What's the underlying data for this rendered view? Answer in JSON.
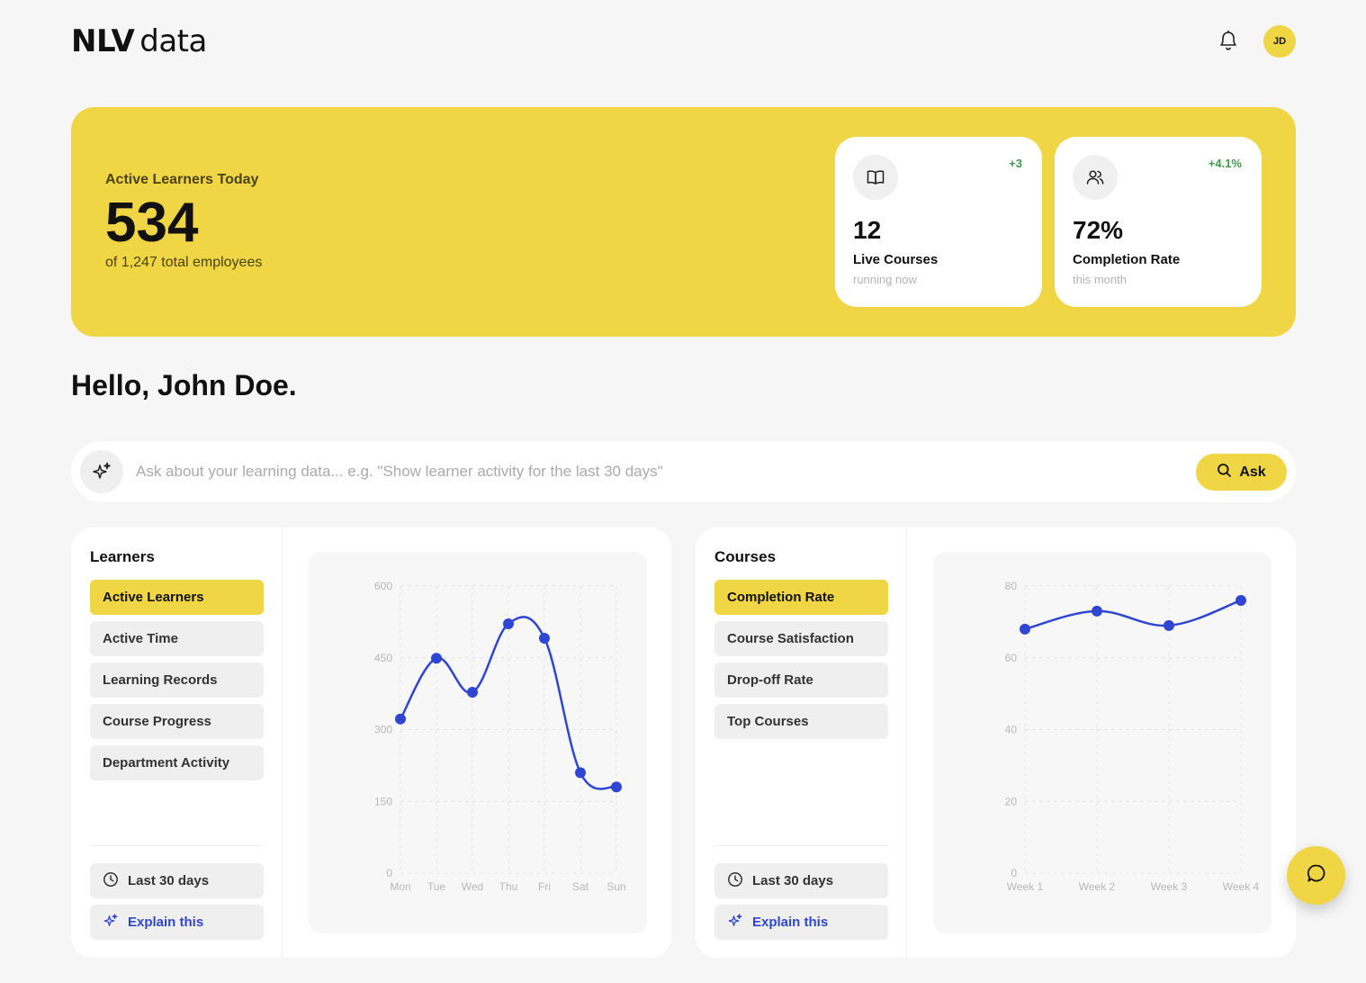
{
  "app": {
    "logo_brand": "NLV",
    "logo_word": "data",
    "avatar_initials": "JD",
    "bell_icon": "bell-icon",
    "accent_color": "#f0d544",
    "line_color": "#2f46d3"
  },
  "hero": {
    "label": "Active Learners Today",
    "value": "534",
    "subtitle": "of 1,247 total employees",
    "cards": [
      {
        "icon": "book-icon",
        "delta": "+3",
        "value": "12",
        "title": "Live Courses",
        "subtitle": "running now"
      },
      {
        "icon": "users-icon",
        "delta": "+4.1%",
        "value": "72%",
        "title": "Completion Rate",
        "subtitle": "this month"
      }
    ]
  },
  "greeting": "Hello, John Doe.",
  "ask": {
    "icon": "sparkle-icon",
    "placeholder": "Ask about your learning data... e.g. \"Show learner activity for the last 30 days\"",
    "button_label": "Ask",
    "button_icon": "search-icon"
  },
  "learners_panel": {
    "title": "Learners",
    "menu": [
      "Active Learners",
      "Active Time",
      "Learning Records",
      "Course Progress",
      "Department Activity"
    ],
    "active_index": 0,
    "range_label": "Last 30 days",
    "explain_label": "Explain this"
  },
  "courses_panel": {
    "title": "Courses",
    "menu": [
      "Completion Rate",
      "Course Satisfaction",
      "Drop-off Rate",
      "Top Courses"
    ],
    "active_index": 0,
    "range_label": "Last 30 days",
    "explain_label": "Explain this"
  },
  "chart_data": [
    {
      "type": "line",
      "categories": [
        "Mon",
        "Tue",
        "Wed",
        "Thu",
        "Fri",
        "Sat",
        "Sun"
      ],
      "values": [
        322,
        449,
        378,
        521,
        491,
        210,
        180
      ],
      "yticks": [
        0,
        150,
        300,
        450,
        600
      ],
      "ylim": [
        0,
        600
      ],
      "grid": true,
      "smooth": true
    },
    {
      "type": "line",
      "categories": [
        "Week 1",
        "Week 2",
        "Week 3",
        "Week 4"
      ],
      "values": [
        68,
        73,
        69,
        76
      ],
      "yticks": [
        0,
        20,
        40,
        60,
        80
      ],
      "ylim": [
        0,
        80
      ],
      "grid": true,
      "smooth": true
    }
  ],
  "fab_icon": "chat-icon"
}
